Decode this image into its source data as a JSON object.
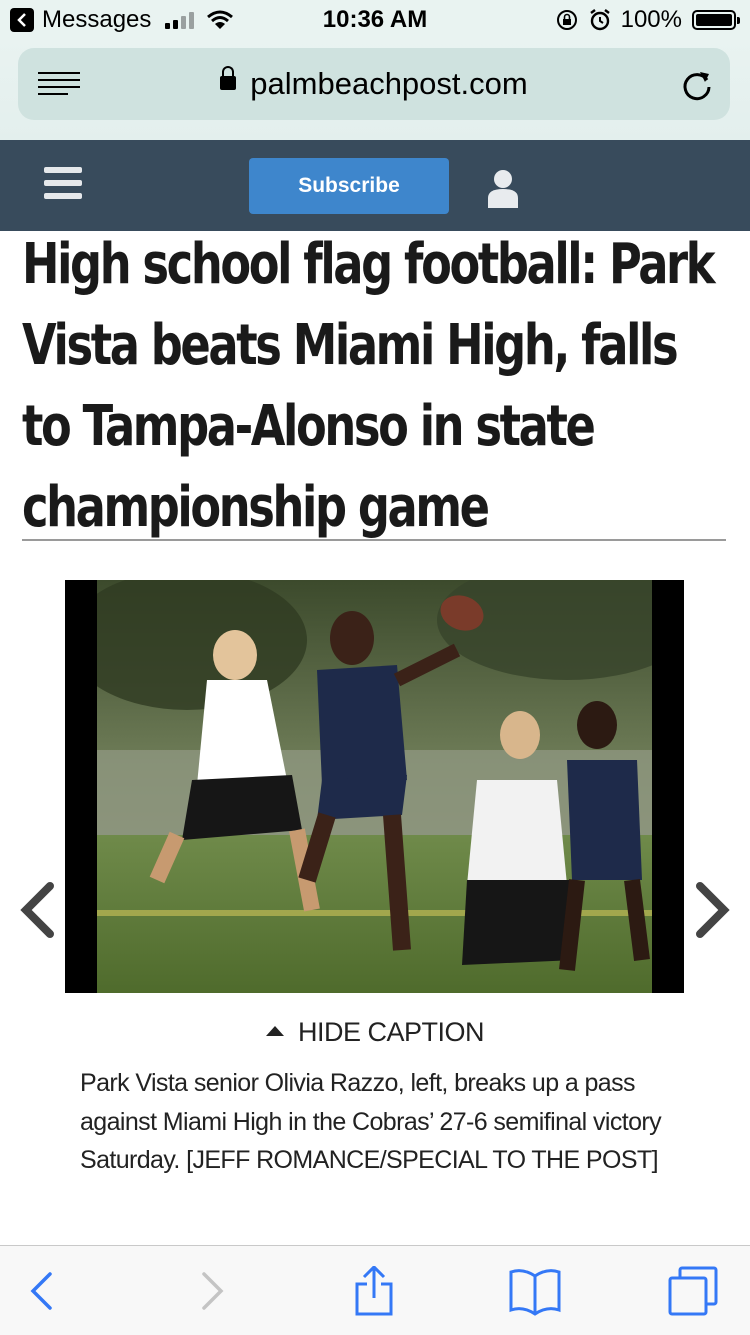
{
  "status_bar": {
    "back_app": "Messages",
    "time": "10:36 AM",
    "battery": "100%",
    "signal_bars_filled": 2
  },
  "browser": {
    "url": "palmbeachpost.com",
    "icons": [
      "reader-icon",
      "lock-icon",
      "reload-icon"
    ]
  },
  "site_header": {
    "subscribe_label": "Subscribe",
    "colors": {
      "bar": "#384b5c",
      "button": "#3e86cc"
    }
  },
  "article": {
    "headline": "High school flag football: Park Vista beats Miami High, falls to Tampa-Alonso in state championship game",
    "gallery": {
      "toggle_label": "HIDE CAPTION",
      "caption": "Park Vista senior Olivia Razzo, left, breaks up a pass against Miami High in the Cobras’ 27-6 semifinal victory Saturday. [JEFF ROMANCE/SPECIAL TO THE POST]"
    }
  },
  "toolbar": {
    "icons": [
      "back-icon",
      "forward-icon",
      "share-icon",
      "bookmarks-icon",
      "tabs-icon"
    ],
    "accent": "#3478f6"
  }
}
